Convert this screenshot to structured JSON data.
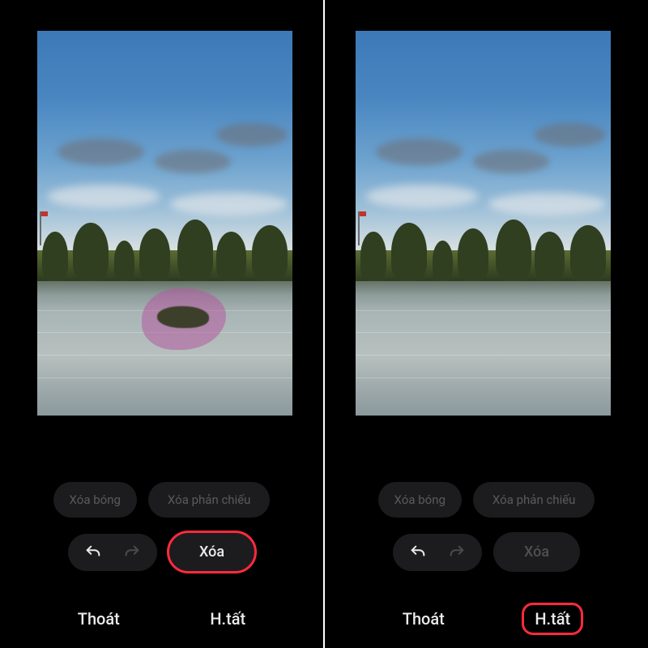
{
  "left": {
    "pills": {
      "shadow": "Xóa bóng",
      "reflection": "Xóa phản chiếu"
    },
    "erase": "Xóa",
    "exit": "Thoát",
    "done": "H.tất",
    "has_selection": true,
    "erase_enabled": true,
    "highlight": "erase"
  },
  "right": {
    "pills": {
      "shadow": "Xóa bóng",
      "reflection": "Xóa phản chiếu"
    },
    "erase": "Xóa",
    "exit": "Thoát",
    "done": "H.tất",
    "has_selection": false,
    "erase_enabled": false,
    "highlight": "done"
  },
  "icons": {
    "undo": "undo-icon",
    "redo": "redo-icon"
  }
}
